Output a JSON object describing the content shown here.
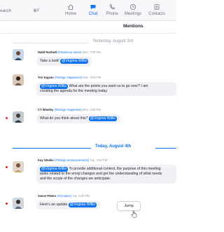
{
  "topbar": {
    "search": {
      "text": "earch",
      "shortcut": "⌘F"
    },
    "nav": [
      {
        "label": "Home",
        "icon": "home-icon",
        "active": false
      },
      {
        "label": "Chat",
        "icon": "chat-icon",
        "active": true
      },
      {
        "label": "Phone",
        "icon": "phone-icon",
        "active": false
      },
      {
        "label": "Meetings",
        "icon": "clock-icon",
        "active": false
      },
      {
        "label": "Contacts",
        "icon": "contacts-icon",
        "active": false
      }
    ]
  },
  "mentions": {
    "title": "Mentions"
  },
  "dividers": [
    {
      "label": "Yesterday, August 3rd"
    },
    {
      "label": "Today, August 4th"
    }
  ],
  "messages": [
    {
      "author": "Nabil Rashedi",
      "channel": "(#Stand-up notes)",
      "time": "Mon, 7:00 PM",
      "parts": [
        "Take a look! ",
        "@Virginia Willis",
        ""
      ],
      "unread": false
    },
    {
      "author": "Tori Kajano",
      "channel": "(#Design Happiness)",
      "time": "Mon, 3:00 PM",
      "parts": [
        "",
        "@Virginia Willis",
        " What are the points you want us to go over? I am"
      ],
      "line2": "creating the agenda for the meeting today",
      "unread": false
    },
    {
      "author": "CT Wiseley",
      "channel": "(#Design Happiness)",
      "time": "Mon, 3:00 PM",
      "parts": [
        "What do you think about this? ",
        "@Virginia Willis",
        ""
      ],
      "unread": true
    },
    {
      "author": "Kay Umeko",
      "channel": "(#Design announcements)",
      "time": "Tue, 4:00 PM",
      "parts": [
        "",
        "@Virginia Willis",
        " To provide additional context, the purpose of this meeting"
      ],
      "line2": "tasks related to the emoji changes and get the understanding of what needs",
      "line3": "and the scope of the changes we anticipate.",
      "unread": true
    },
    {
      "author": "Vance Peters",
      "channel": "(#Creative)",
      "time": "Tue, 5:00 PM",
      "parts": [
        "Here's an update ",
        "@Virginia Willis",
        ""
      ],
      "unread": true
    }
  ],
  "jump_button": {
    "label": "Jump"
  },
  "colors": {
    "accent": "#0e72ed",
    "unread": "#e02828",
    "bubble": "#f0f1f4"
  }
}
